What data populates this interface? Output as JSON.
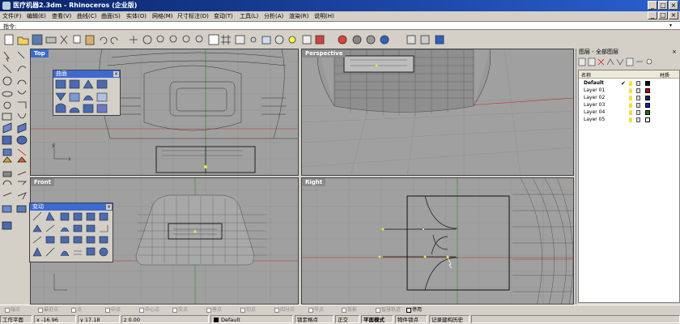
{
  "window": {
    "title": "医疗机器2.3dm - Rhinoceros (企业版)",
    "minimize": "_",
    "maximize": "□",
    "close": "×"
  },
  "menu": [
    "文件(F)",
    "编辑(E)",
    "查看(V)",
    "曲线(C)",
    "曲面(S)",
    "实体(O)",
    "网格(M)",
    "尺寸标注(D)",
    "变动(T)",
    "工具(L)",
    "分析(A)",
    "渲染(R)",
    "说明(H)"
  ],
  "command": {
    "label": "指令:",
    "value": ""
  },
  "toolbar_icons": [
    "new-icon",
    "open-icon",
    "save-icon",
    "print-icon",
    "cut-icon",
    "copy-icon",
    "paste-icon",
    "undo-icon",
    "redo-icon",
    "pan-icon",
    "rotate-view-icon",
    "zoom-dynamic-icon",
    "zoom-window-icon",
    "zoom-extents-icon",
    "zoom-selected-icon",
    "four-viewports-icon",
    "grid-icon",
    "properties-icon",
    "points-on-icon",
    "layer-icon",
    "render-icon",
    "wireframe-icon",
    "shaded-icon",
    "rendered-shade-icon",
    "light-icon",
    "options-icon",
    "help-icon"
  ],
  "viewports": {
    "top": {
      "title": "Top"
    },
    "perspective": {
      "title": "Perspective"
    },
    "front": {
      "title": "Front"
    },
    "right": {
      "title": "Right"
    }
  },
  "palettes": {
    "surface": {
      "title": "曲面",
      "close": "×"
    },
    "transform": {
      "title": "变动",
      "close": "×"
    }
  },
  "layer_panel": {
    "title": "图层 - 全部图层",
    "columns": {
      "name": "名称",
      "material": "材质"
    },
    "layers": [
      {
        "name": "Default",
        "current": true,
        "color": "#000000"
      },
      {
        "name": "Layer 01",
        "color": "#c00000"
      },
      {
        "name": "Layer 02",
        "color": "#20207a"
      },
      {
        "name": "Layer 03",
        "color": "#1a1ab0"
      },
      {
        "name": "Layer 04",
        "color": "#1e6e1e"
      },
      {
        "name": "Layer 05",
        "color": "#ffffff"
      }
    ]
  },
  "osnaps": [
    {
      "label": "端点",
      "on": false
    },
    {
      "label": "最近点",
      "on": false
    },
    {
      "label": "点",
      "on": false
    },
    {
      "label": "中点",
      "on": false
    },
    {
      "label": "中心点",
      "on": false
    },
    {
      "label": "交点",
      "on": false
    },
    {
      "label": "垂点",
      "on": false
    },
    {
      "label": "切点",
      "on": false
    },
    {
      "label": "四分点",
      "on": false
    },
    {
      "label": "节点",
      "on": false
    },
    {
      "label": "投影",
      "on": false
    },
    {
      "label": "智慧轨迹",
      "on": false
    },
    {
      "label": "停用",
      "on": true
    }
  ],
  "status": {
    "cplane": "工作平面",
    "x": "x -16.96",
    "y": "y 17.18",
    "z": "z 0.00",
    "layer": "Default",
    "snap": "锁定格点",
    "ortho": "正交",
    "planar": "平面模式",
    "osnap": "物件锁点",
    "history": "记录建构历史"
  }
}
